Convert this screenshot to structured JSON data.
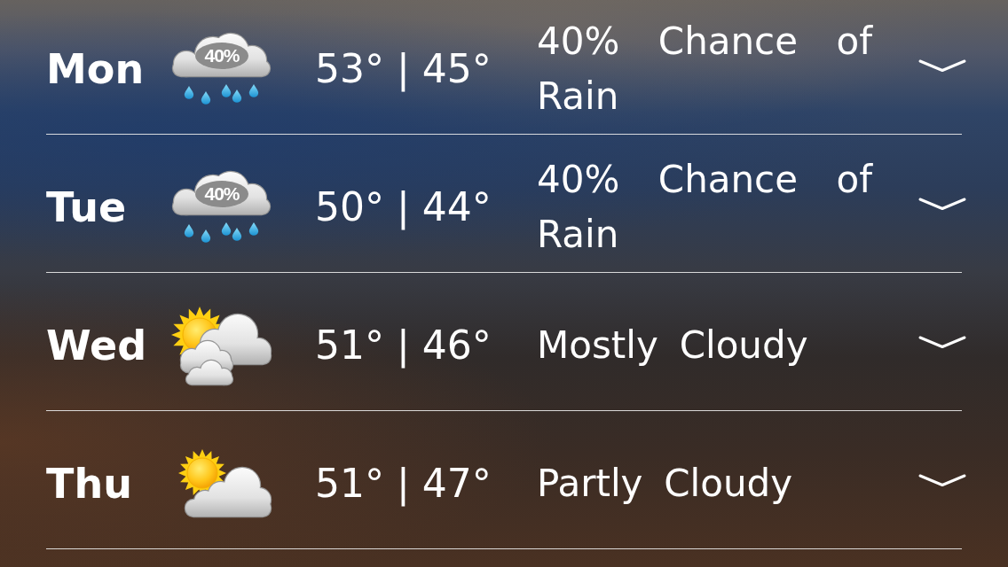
{
  "forecast": [
    {
      "day": "Mon",
      "icon": {
        "kind": "rain",
        "label": "40%"
      },
      "temperature": "53° | 45°",
      "condition": "40% Chance of Rain",
      "expanded": false
    },
    {
      "day": "Tue",
      "icon": {
        "kind": "rain",
        "label": "40%"
      },
      "temperature": "50° | 44°",
      "condition": "40% Chance of Rain",
      "expanded": false
    },
    {
      "day": "Wed",
      "icon": {
        "kind": "mostly_cloudy"
      },
      "temperature": "51° | 46°",
      "condition": "Mostly Cloudy",
      "expanded": false
    },
    {
      "day": "Thu",
      "icon": {
        "kind": "partly_cloudy"
      },
      "temperature": "51° | 47°",
      "condition": "Partly Cloudy",
      "expanded": false
    }
  ]
}
